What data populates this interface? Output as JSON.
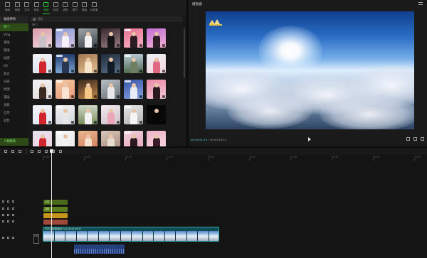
{
  "toolbar": {
    "tools": [
      {
        "name": "media",
        "label": "媒体"
      },
      {
        "name": "audio",
        "label": "音频"
      },
      {
        "name": "text",
        "label": "文本"
      },
      {
        "name": "sticker",
        "label": "贴纸"
      },
      {
        "name": "effects",
        "label": "特效",
        "active": true
      },
      {
        "name": "transition",
        "label": "转场"
      },
      {
        "name": "filter",
        "label": "滤镜"
      },
      {
        "name": "adjust",
        "label": "调节"
      },
      {
        "name": "template",
        "label": "模板"
      },
      {
        "name": "ai",
        "label": "AI效果"
      }
    ]
  },
  "categories": {
    "header": "画面特效",
    "items": [
      "热门",
      "Vlog",
      "基础",
      "氛围",
      "动感",
      "DV",
      "复古",
      "分屏",
      "纹理",
      "漫画",
      "金粉",
      "自然",
      "投影"
    ],
    "bottom": "人物特效"
  },
  "library": {
    "search_placeholder": "搜索",
    "section": "热门"
  },
  "player": {
    "title": "播放器",
    "timecode": "00:00:01:15",
    "duration": "00:00:28:21"
  },
  "timeline": {
    "ticks": [
      "00:00",
      "00:05",
      "00:10",
      "00:15",
      "00:20",
      "00:25",
      "00:30",
      "00:35",
      "00:40",
      "00:45"
    ],
    "clips": {
      "effect1": "氛围",
      "effect2": "金粉",
      "filter": "",
      "adjust": ""
    },
    "video_label": "天空云层视频素材.mp4  00:00:28:21",
    "cover_label": "封面",
    "audio_label": ""
  },
  "colors": {
    "accent": "#2bd12b",
    "playhead": "#e6e6e6",
    "video_clip": "#124a50",
    "audio_clip": "#24407a",
    "filter_clip": "#c6941a",
    "adjust_clip": "#a24a3a"
  }
}
